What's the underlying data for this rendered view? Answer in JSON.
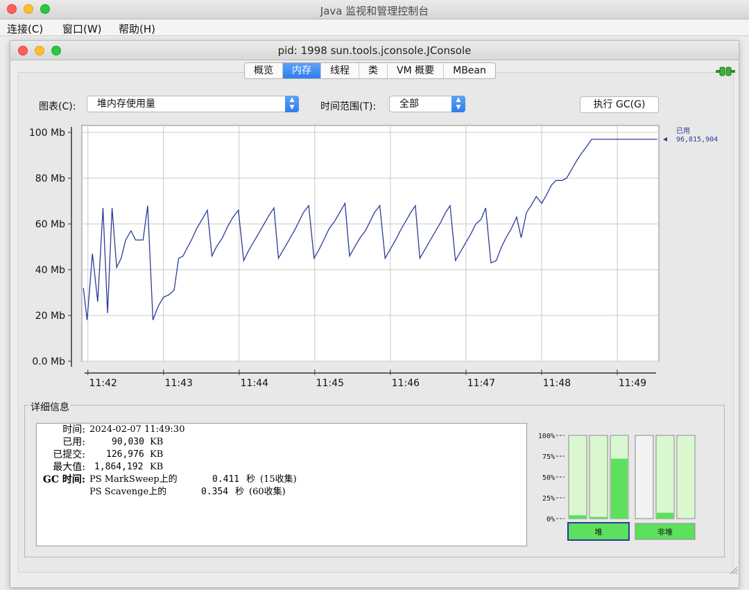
{
  "outer_window": {
    "title": "Java 监视和管理控制台",
    "menu": [
      "连接(C)",
      "窗口(W)",
      "帮助(H)"
    ]
  },
  "inner_window": {
    "title": "pid: 1998 sun.tools.jconsole.JConsole"
  },
  "tabs": [
    {
      "label": "概览",
      "active": false
    },
    {
      "label": "内存",
      "active": true
    },
    {
      "label": "线程",
      "active": false
    },
    {
      "label": "类",
      "active": false
    },
    {
      "label": "VM 概要",
      "active": false
    },
    {
      "label": "MBean",
      "active": false
    }
  ],
  "controls": {
    "chart_label": "图表(C):",
    "chart_select": "堆内存使用量",
    "time_range_label": "时间范围(T):",
    "time_range_select": "全部",
    "gc_button": "执行 GC(G)"
  },
  "chart_data": {
    "type": "line",
    "ylim": [
      0,
      100
    ],
    "y_ticks": [
      "0.0 Mb",
      "20 Mb",
      "40 Mb",
      "60 Mb",
      "80 Mb",
      "100 Mb"
    ],
    "x_ticks": [
      "11:42",
      "11:43",
      "11:44",
      "11:45",
      "11:46",
      "11:47",
      "11:48",
      "11:49"
    ],
    "xlim": [
      11.6667,
      11.8333
    ],
    "x_tick_values": [
      0,
      1,
      2,
      3,
      4,
      5,
      6,
      7
    ],
    "series": [
      {
        "name": "已用",
        "color": "#2a3a9a",
        "x": [
          -0.06,
          -0.01,
          0.06,
          0.13,
          0.2,
          0.26,
          0.32,
          0.38,
          0.44,
          0.5,
          0.57,
          0.63,
          0.68,
          0.73,
          0.79,
          0.86,
          0.93,
          1.0,
          1.07,
          1.14,
          1.2,
          1.26,
          1.32,
          1.37,
          1.44,
          1.51,
          1.58,
          1.64,
          1.7,
          1.78,
          1.85,
          1.92,
          1.99,
          2.06,
          2.12,
          2.19,
          2.26,
          2.33,
          2.4,
          2.46,
          2.52,
          2.59,
          2.66,
          2.73,
          2.79,
          2.85,
          2.92,
          2.99,
          3.06,
          3.12,
          3.19,
          3.26,
          3.33,
          3.4,
          3.46,
          3.53,
          3.6,
          3.67,
          3.73,
          3.79,
          3.86,
          3.93,
          4.0,
          4.07,
          4.13,
          4.2,
          4.27,
          4.33,
          4.39,
          4.46,
          4.53,
          4.6,
          4.67,
          4.73,
          4.79,
          4.86,
          4.93,
          5.0,
          5.07,
          5.13,
          5.2,
          5.26,
          5.33,
          5.4,
          5.47,
          5.53,
          5.6,
          5.67,
          5.73,
          5.8,
          5.86,
          5.93,
          6.0,
          6.07,
          6.13,
          6.19,
          6.27,
          6.33,
          6.4,
          6.47,
          6.53,
          6.6,
          6.66,
          6.73,
          6.8,
          6.86,
          6.93,
          6.99,
          7.06,
          7.13,
          7.2,
          7.26,
          7.33,
          7.4,
          7.46,
          7.53
        ],
        "values": [
          32,
          18,
          47,
          26,
          67,
          21,
          67,
          41,
          45,
          53,
          57,
          53,
          53,
          53,
          68,
          18,
          24,
          28,
          29,
          31,
          45,
          46,
          50,
          53,
          58,
          62,
          66,
          46,
          50,
          54,
          59,
          63,
          66,
          44,
          48,
          52,
          56,
          60,
          64,
          67,
          45,
          49,
          53,
          57,
          61,
          65,
          68,
          45,
          49,
          53,
          58,
          61,
          65,
          69,
          46,
          50,
          54,
          57,
          61,
          65,
          68,
          45,
          49,
          53,
          57,
          61,
          65,
          68,
          45,
          49,
          53,
          57,
          61,
          65,
          68,
          44,
          48,
          52,
          56,
          60,
          62,
          67,
          43,
          44,
          50,
          54,
          58,
          63,
          54,
          65,
          68,
          72,
          69,
          73,
          77,
          79,
          79,
          80,
          84,
          88,
          91,
          94,
          97,
          97,
          97,
          97,
          97,
          97,
          97,
          97,
          97,
          97,
          97,
          97,
          97,
          97
        ]
      }
    ],
    "legend_label": "已用",
    "current_value": "96,815,904"
  },
  "details": {
    "section_label": "详细信息",
    "time_key": "时间:",
    "time_value": "2024-02-07 11:49:30",
    "used_key": "已用:",
    "used_value": "90,030",
    "used_unit": "KB",
    "committed_key": "已提交:",
    "committed_value": "126,976",
    "committed_unit": "KB",
    "max_key": "最大值:",
    "max_value": "1,864,192",
    "max_unit": "KB",
    "gc_key": "GC 时间:",
    "gc_rows": [
      {
        "name": "PS MarkSweep上的",
        "time": "0.411",
        "unit": "秒",
        "count": "(15收集)"
      },
      {
        "name": "PS Scavenge上的",
        "time": "0.354",
        "unit": "秒",
        "count": "(60收集)"
      }
    ]
  },
  "pool_chart": {
    "ticks": [
      "100%",
      "75%",
      "50%",
      "25%",
      "0%"
    ],
    "bars": [
      {
        "group": "heap",
        "fill": 0.04
      },
      {
        "group": "heap",
        "fill": 0.02
      },
      {
        "group": "heap",
        "fill": 0.72
      },
      {
        "group": "nonheap",
        "fill": 0.0
      },
      {
        "group": "nonheap",
        "fill": 0.07
      },
      {
        "group": "nonheap",
        "fill": 0.0
      }
    ],
    "heap_label": "堆",
    "nonheap_label": "非堆",
    "bar_fill_color": "#5de05d",
    "bar_bg_color": "#d9f8d0"
  }
}
